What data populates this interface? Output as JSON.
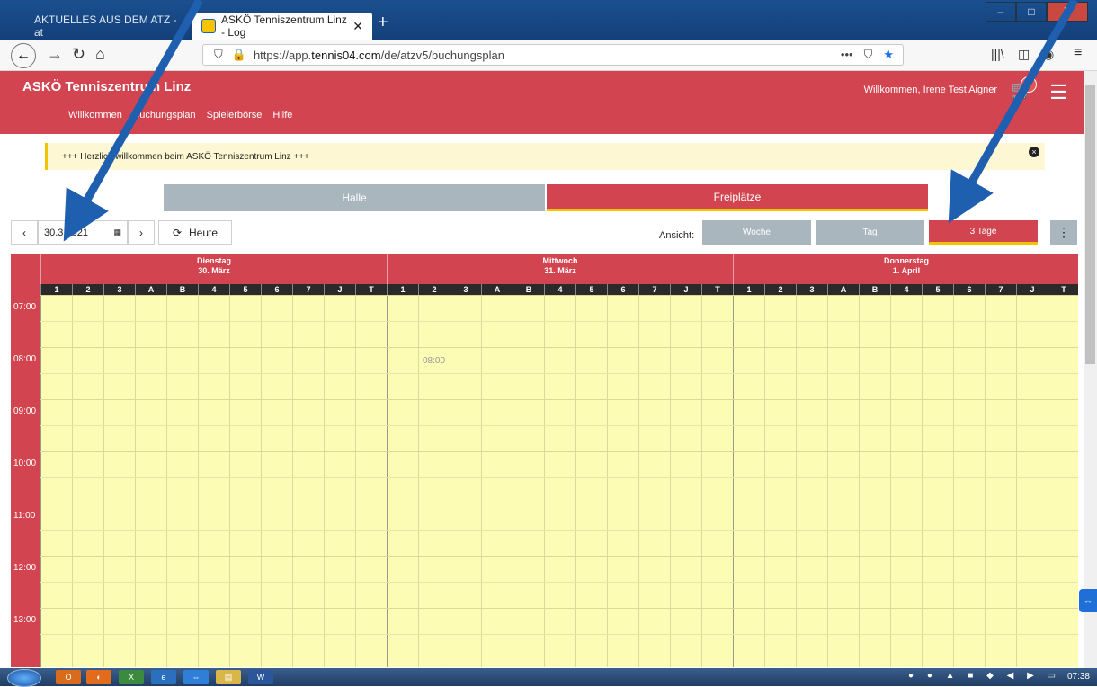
{
  "browser": {
    "tabs": [
      {
        "label": "AKTUELLES AUS DEM ATZ - at"
      },
      {
        "label": "ASKÖ Tenniszentrum Linz - Log"
      }
    ],
    "new_tab": "+",
    "url_scheme": "https://app.",
    "url_host": "tennis04.com",
    "url_path": "/de/atzv5/buchungsplan",
    "window_controls": [
      "–",
      "□",
      "X"
    ]
  },
  "app": {
    "title": "ASKÖ Tenniszentrum Linz",
    "nav": [
      "Willkommen",
      "Buchungsplan",
      "Spielerbörse",
      "Hilfe"
    ],
    "welcome": "Willkommen, Irene Test Aigner",
    "cart_count": "0",
    "notice": "+++ Herzlich willkommen beim ASKÖ Tenniszentrum Linz +++",
    "notice_close": "×"
  },
  "tabs": {
    "halle": "Halle",
    "freiplaetze": "Freiplätze",
    "selected": "Freiplätze"
  },
  "controls": {
    "date": "30.3.2021",
    "today": "Heute",
    "ansicht_label": "Ansicht:",
    "views": [
      "Woche",
      "Tag",
      "3 Tage"
    ],
    "selected_view": "3 Tage",
    "more": "⋮"
  },
  "calendar": {
    "days": [
      {
        "name": "Dienstag",
        "date": "30. März"
      },
      {
        "name": "Mittwoch",
        "date": "31. März"
      },
      {
        "name": "Donnerstag",
        "date": "1. April"
      }
    ],
    "courts": [
      "1",
      "2",
      "3",
      "A",
      "B",
      "4",
      "5",
      "6",
      "7",
      "J",
      "T"
    ],
    "times": [
      "07:00",
      "08:00",
      "09:00",
      "10:00",
      "11:00",
      "12:00",
      "13:00"
    ],
    "marker_label": "08:00"
  },
  "taskbar": {
    "clock": "07:38"
  }
}
